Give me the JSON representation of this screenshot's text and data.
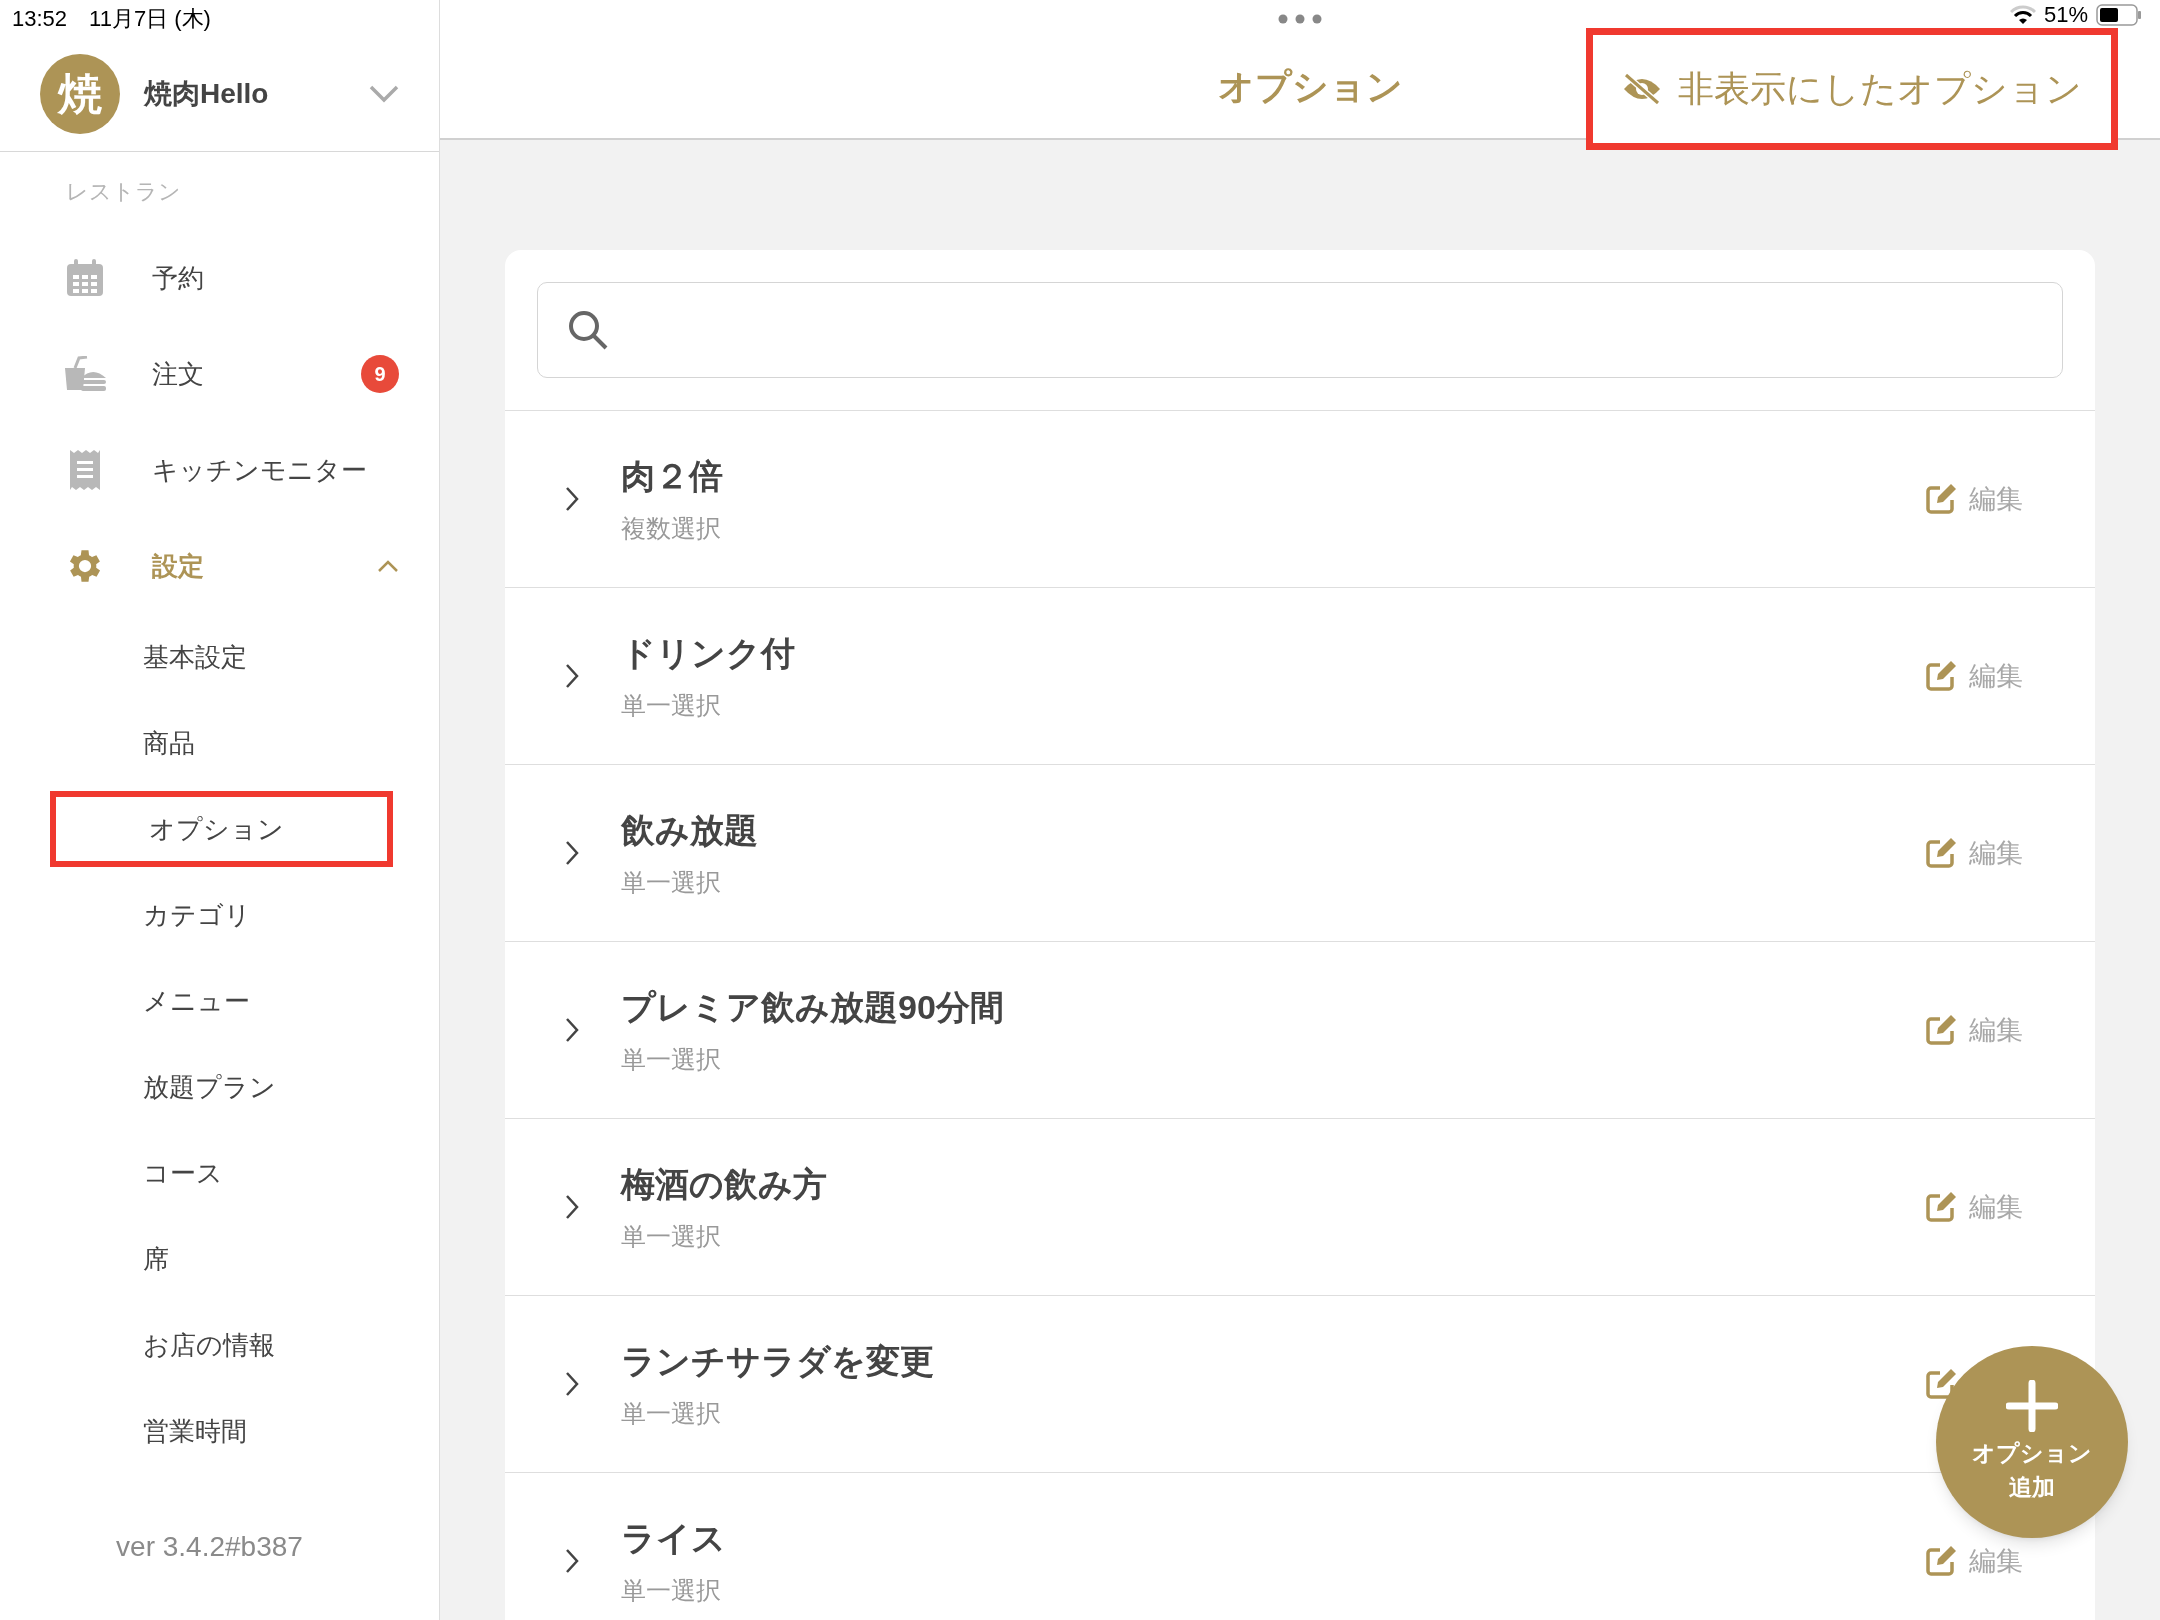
{
  "status_bar": {
    "time": "13:52",
    "date": "11月7日 (木)",
    "battery": "51%"
  },
  "account": {
    "avatar": "焼",
    "name": "焼肉Hello"
  },
  "sidebar": {
    "section": "レストラン",
    "items": [
      {
        "label": "予約",
        "kind": "calendar",
        "active": false
      },
      {
        "label": "注文",
        "kind": "order",
        "badge": "9",
        "active": false
      },
      {
        "label": "キッチンモニター",
        "kind": "receipt",
        "active": false
      },
      {
        "label": "設定",
        "kind": "settings",
        "active": true,
        "expanded": true,
        "children": [
          {
            "label": "基本設定",
            "highlighted": false
          },
          {
            "label": "商品",
            "highlighted": false
          },
          {
            "label": "オプション",
            "highlighted": true
          },
          {
            "label": "カテゴリ",
            "highlighted": false
          },
          {
            "label": "メニュー",
            "highlighted": false
          },
          {
            "label": "放題プラン",
            "highlighted": false
          },
          {
            "label": "コース",
            "highlighted": false
          },
          {
            "label": "席",
            "highlighted": false
          },
          {
            "label": "お店の情報",
            "highlighted": false
          },
          {
            "label": "営業時間",
            "highlighted": false
          }
        ]
      }
    ],
    "version": "ver 3.4.2#b387"
  },
  "header": {
    "title": "オプション",
    "hidden_button": {
      "label": "非表示にしたオプション",
      "highlighted": true
    }
  },
  "options": [
    {
      "name": "肉２倍",
      "type": "複数選択",
      "edit": "編集"
    },
    {
      "name": "ドリンク付",
      "type": "単一選択",
      "edit": "編集"
    },
    {
      "name": "飲み放題",
      "type": "単一選択",
      "edit": "編集"
    },
    {
      "name": "プレミア飲み放題90分間",
      "type": "単一選択",
      "edit": "編集"
    },
    {
      "name": "梅酒の飲み方",
      "type": "単一選択",
      "edit": "編集"
    },
    {
      "name": "ランチサラダを変更",
      "type": "単一選択"
    },
    {
      "name": "ライス",
      "type": "単一選択",
      "edit": "編集"
    }
  ],
  "fab": {
    "line1": "オプション",
    "line2": "追加"
  }
}
